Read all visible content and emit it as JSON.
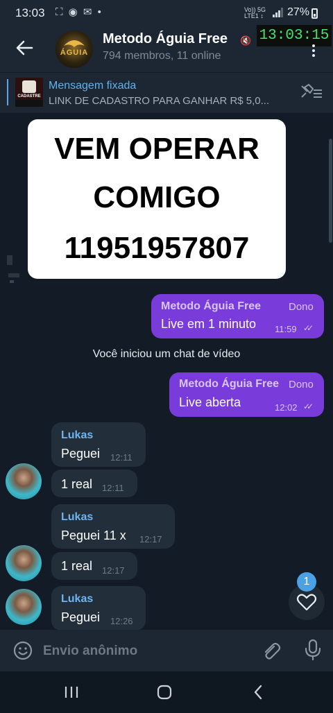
{
  "status_bar": {
    "time": "13:03",
    "left_icons": "⛶ ◉ ✉ •",
    "network_top": "Vo)) 5G",
    "network_bottom": "LTE1 ↕",
    "battery": "27%"
  },
  "header": {
    "title": "Metodo Águia Free",
    "subtitle": "794 membros, 11 online",
    "avatar_text": "ÁGUIA",
    "clock": "13:03:15"
  },
  "pinned": {
    "label": "Mensagem fixada",
    "text": "LINK DE CADASTRO PARA GANHAR  R$ 5,0...",
    "thumb_text": "CADASTRE"
  },
  "overlay": {
    "line1": "VEM OPERAR",
    "line2": "COMIGO",
    "line3": "11951957807"
  },
  "messages": {
    "m1": {
      "sender": "Metodo Águia Free",
      "role": "Dono",
      "text": "Live em 1 minuto",
      "time": "11:59"
    },
    "service": "Você iniciou um chat de vídeo",
    "m2": {
      "sender": "Metodo Águia Free",
      "role": "Dono",
      "text": "Live aberta",
      "time": "12:02"
    },
    "m3": {
      "sender": "Lukas",
      "text": "Peguei",
      "time": "12:11"
    },
    "m4": {
      "text": "1 real",
      "time": "12:11"
    },
    "m5": {
      "sender": "Lukas",
      "text": "Peguei 11 x",
      "time": "12:17"
    },
    "m6": {
      "text": "1 real",
      "time": "12:17"
    },
    "m7": {
      "sender": "Lukas",
      "text": "Peguei",
      "time": "12:26"
    }
  },
  "reaction": {
    "count": "1"
  },
  "composer": {
    "placeholder": "Envio anônimo"
  },
  "colors": {
    "outgoing_bubble": "#7a3bdb",
    "incoming_bubble": "#222e3a",
    "link_blue": "#5fb2ee",
    "clock_green": "#47e26a"
  },
  "icons": {
    "back": "arrow-left-icon",
    "menu": "more-vertical-icon",
    "pin_list": "pin-list-icon",
    "emoji": "emoji-icon",
    "attach": "paperclip-icon",
    "mic": "microphone-icon",
    "heart": "heart-icon"
  }
}
